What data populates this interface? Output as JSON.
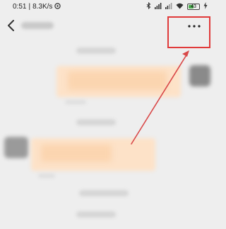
{
  "status_bar": {
    "time": "0:51",
    "network_speed": "8.3K/s",
    "battery_level": "43",
    "icons": [
      "hotspot-icon",
      "bluetooth-icon",
      "signal-icon",
      "signal-icon",
      "wifi-icon",
      "battery-icon",
      "charging-icon"
    ]
  },
  "nav": {
    "back_icon": "chevron-left-icon",
    "more_icon": "more-dots-icon"
  },
  "annotation": {
    "highlight_color": "#e03a3a",
    "arrow_color": "#d94848"
  },
  "colors": {
    "background": "#eeeeee",
    "bubble": "#fde2c8"
  }
}
